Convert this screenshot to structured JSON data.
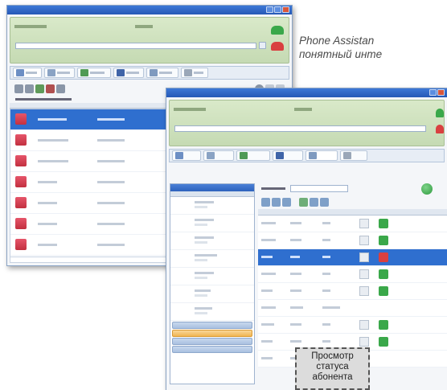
{
  "promo": {
    "line1": "Phone Assistan",
    "line2": "понятный инте"
  },
  "tooltip": {
    "line1": "Просмотр",
    "line2": "статуса",
    "line3": "абонента"
  },
  "colors": {
    "titlebar": "#2f68c9",
    "lcd": "#cfe2bd",
    "selection": "#2f6fcf",
    "call_green": "#3aa84a",
    "hangup_red": "#d94040",
    "orange_button": "#f0b552"
  },
  "icons": [
    "close-icon",
    "minimize-icon",
    "maximize-icon",
    "call-icon",
    "hangup-icon",
    "contact-avatar-icon",
    "phone-icon",
    "status-icon",
    "search-icon"
  ]
}
